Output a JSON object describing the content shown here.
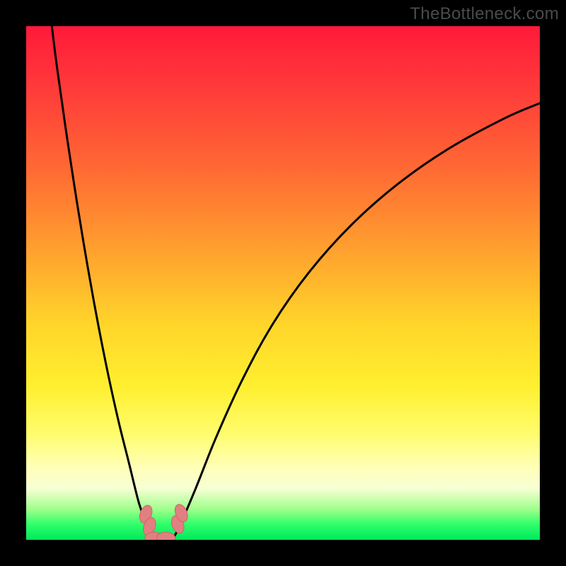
{
  "watermark": "TheBottleneck.com",
  "chart_data": {
    "type": "line",
    "title": "",
    "xlabel": "",
    "ylabel": "",
    "xlim": [
      0,
      100
    ],
    "ylim": [
      0,
      100
    ],
    "grid": false,
    "series": [
      {
        "name": "left-curve",
        "x": [
          5,
          6,
          8,
          10,
          12,
          14,
          16,
          18,
          20,
          22,
          23.5,
          24.5
        ],
        "y": [
          100,
          92,
          78,
          65,
          53,
          42,
          32,
          23,
          15,
          7,
          3,
          0
        ]
      },
      {
        "name": "right-curve",
        "x": [
          28.5,
          30,
          33,
          37,
          42,
          48,
          55,
          63,
          72,
          82,
          93,
          100
        ],
        "y": [
          0,
          3,
          10,
          20,
          31,
          42,
          52,
          61,
          69,
          76,
          82,
          85
        ]
      },
      {
        "name": "floor-segment",
        "x": [
          24.5,
          28.5
        ],
        "y": [
          0,
          0
        ]
      }
    ],
    "markers": [
      {
        "name": "marker-left-a",
        "x": 23.3,
        "y": 5.0,
        "angle": -70
      },
      {
        "name": "marker-left-b",
        "x": 24.0,
        "y": 2.6,
        "angle": -70
      },
      {
        "name": "marker-right-a",
        "x": 29.5,
        "y": 3.0,
        "angle": 68
      },
      {
        "name": "marker-right-b",
        "x": 30.2,
        "y": 5.2,
        "angle": 68
      },
      {
        "name": "marker-floor-a",
        "x": 24.9,
        "y": 0.4,
        "angle": 0
      },
      {
        "name": "marker-floor-b",
        "x": 27.2,
        "y": 0.4,
        "angle": 0
      }
    ],
    "colors": {
      "curve": "#000000",
      "marker_fill": "#e08080",
      "marker_stroke": "#cc6666"
    }
  }
}
